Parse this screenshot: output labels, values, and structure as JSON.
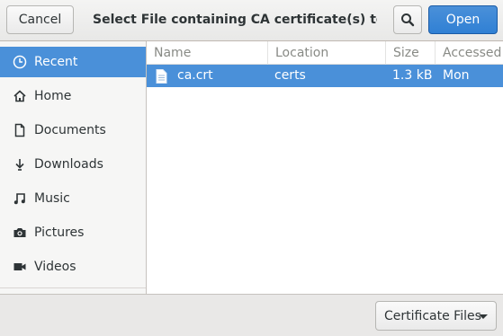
{
  "header": {
    "cancel_label": "Cancel",
    "title": "Select File containing CA certificate(s) to imp…",
    "search_icon": "search-icon",
    "open_label": "Open"
  },
  "sidebar": {
    "items": [
      {
        "label": "Recent",
        "icon": "clock-icon",
        "selected": true
      },
      {
        "label": "Home",
        "icon": "home-icon"
      },
      {
        "label": "Documents",
        "icon": "document-icon"
      },
      {
        "label": "Downloads",
        "icon": "download-icon"
      },
      {
        "label": "Music",
        "icon": "music-icon"
      },
      {
        "label": "Pictures",
        "icon": "camera-icon"
      },
      {
        "label": "Videos",
        "icon": "video-icon"
      }
    ]
  },
  "filelist": {
    "columns": [
      "Name",
      "Location",
      "Size",
      "Accessed"
    ],
    "rows": [
      {
        "name": "ca.crt",
        "location": "certs",
        "size": "1.3 kB",
        "accessed": "Mon",
        "icon": "text-file-icon",
        "selected": true
      }
    ]
  },
  "footer": {
    "filter_label": "Certificate Files"
  },
  "colors": {
    "accent": "#4a90d9",
    "sidebar_bg": "#f6f6f5",
    "header_bg": "#e8e8e7"
  }
}
